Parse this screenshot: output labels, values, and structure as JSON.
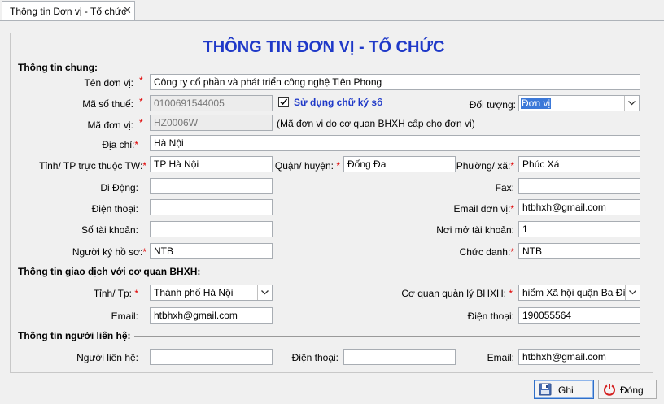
{
  "tab": {
    "label": "Thông tin Đơn vị - Tổ chức",
    "close": "✕"
  },
  "title": "THÔNG TIN ĐƠN VỊ - TỔ CHỨC",
  "general": {
    "heading": "Thông tin chung:",
    "ten_don_vi": {
      "label": "Tên đơn vị:",
      "value": "Công ty cổ phần và phát triển công nghệ Tiên Phong"
    },
    "ma_so_thue": {
      "label": "Mã số thuế:",
      "value": "0100691544005"
    },
    "chu_ky_so": {
      "label": "Sử dụng chữ ký số",
      "checked": true
    },
    "doi_tuong": {
      "label": "Đối tượng:",
      "value": "Đơn vị"
    },
    "ma_don_vi": {
      "label": "Mã đơn vị:",
      "value": "HZ0006W",
      "note": "(Mã đơn vị do cơ quan BHXH cấp cho đơn vị)"
    },
    "dia_chi": {
      "label": "Địa chỉ:",
      "value": "Hà Nội"
    },
    "tinh": {
      "label": "Tỉnh/ TP trực thuộc TW:",
      "value": "TP Hà Nội"
    },
    "quan": {
      "label": "Quận/ huyện:",
      "value": "Đống Đa"
    },
    "phuong": {
      "label": "Phường/ xã:",
      "value": "Phúc Xá"
    },
    "di_dong": {
      "label": "Di Động:",
      "value": ""
    },
    "fax": {
      "label": "Fax:",
      "value": ""
    },
    "dien_thoai": {
      "label": "Điện thoại:",
      "value": ""
    },
    "email": {
      "label": "Email đơn vị:",
      "value": "htbhxh@gmail.com"
    },
    "so_tk": {
      "label": "Số tài khoản:",
      "value": ""
    },
    "noi_mo_tk": {
      "label": "Nơi mở tài khoản:",
      "value": "1"
    },
    "nguoi_ky": {
      "label": "Người ký hồ sơ:",
      "value": "NTB"
    },
    "chuc_danh": {
      "label": "Chức danh:",
      "value": "NTB"
    }
  },
  "bhxh": {
    "heading": "Thông tin giao dịch với cơ quan BHXH:",
    "tinh": {
      "label": "Tỉnh/ Tp:",
      "value": "Thành phố Hà Nội"
    },
    "co_quan": {
      "label": "Cơ quan quản lý BHXH:",
      "value": "hiểm Xã hội quận Ba Đình"
    },
    "email": {
      "label": "Email:",
      "value": "htbhxh@gmail.com"
    },
    "dien_thoai": {
      "label": "Điện thoại:",
      "value": "190055564"
    }
  },
  "contact": {
    "heading": "Thông tin người liên hệ:",
    "nguoi_lien_he": {
      "label": "Người liên hệ:",
      "value": ""
    },
    "dien_thoai": {
      "label": "Điện thoại:",
      "value": ""
    },
    "email": {
      "label": "Email:",
      "value": "htbhxh@gmail.com"
    }
  },
  "buttons": {
    "save": "Ghi",
    "close": "Đóng"
  },
  "required_mark": "*",
  "colors": {
    "title": "#1f39c8",
    "required": "#e00000",
    "selection": "#3b78d8"
  }
}
